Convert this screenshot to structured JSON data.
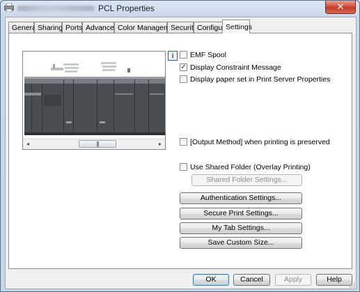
{
  "window": {
    "title": "PCL Properties",
    "close_glyph": "✕"
  },
  "tabs": [
    {
      "label": "General"
    },
    {
      "label": "Sharing"
    },
    {
      "label": "Ports"
    },
    {
      "label": "Advanced"
    },
    {
      "label": "Color Management"
    },
    {
      "label": "Security"
    },
    {
      "label": "Configure"
    },
    {
      "label": "Settings",
      "active": true
    }
  ],
  "preview": {
    "scroll_left": "◂",
    "scroll_right": "▸",
    "thumb_grip": "|||"
  },
  "info_icon": "i",
  "options": {
    "emf_spool": {
      "label": "EMF Spool",
      "checked": false
    },
    "display_constraint": {
      "label": "Display Constraint Message",
      "checked": true,
      "mark": "✓"
    },
    "display_paper_set": {
      "label": "Display paper set in Print Server Properties",
      "checked": false
    },
    "output_method": {
      "label": "[Output Method] when printing is preserved",
      "checked": false
    },
    "shared_folder": {
      "label": "Use Shared Folder (Overlay Printing)",
      "checked": false
    }
  },
  "buttons": {
    "shared_folder_settings": "Shared Folder Settings...",
    "authentication_settings": "Authentication Settings...",
    "secure_print_settings": "Secure Print Settings...",
    "my_tab_settings": "My Tab Settings...",
    "save_custom_size": "Save Custom Size..."
  },
  "footer": {
    "ok": "OK",
    "cancel": "Cancel",
    "apply": "Apply",
    "help": "Help"
  }
}
